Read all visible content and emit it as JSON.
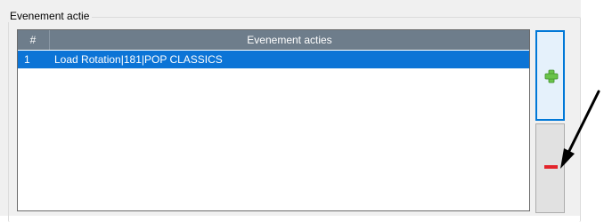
{
  "group": {
    "title": "Evenement actie"
  },
  "grid": {
    "columns": [
      "#",
      "Evenement acties"
    ],
    "rows": [
      {
        "num": "1",
        "action": "Load Rotation|181|POP CLASSICS",
        "selected": true
      }
    ]
  },
  "buttons": {
    "add_icon": "green-plus-icon",
    "remove_icon": "red-minus-icon"
  },
  "colors": {
    "selection": "#0c74d6",
    "header": "#6e7d8b",
    "plus": "#69c34a",
    "minus": "#e3242b",
    "annotation_arrow": "#000000"
  }
}
